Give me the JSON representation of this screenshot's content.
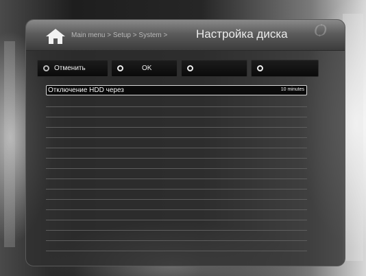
{
  "header": {
    "breadcrumb": "Main menu > Setup > System >",
    "title": "Настройка диска",
    "brand": "Ѻ"
  },
  "buttons": [
    {
      "label": "Отменить",
      "icon": "red-circle-icon"
    },
    {
      "label": "OK",
      "icon": "green-circle-icon"
    },
    {
      "label": "",
      "icon": "yellow-circle-icon"
    },
    {
      "label": "",
      "icon": "blue-circle-icon"
    }
  ],
  "settings": [
    {
      "label": "Отключение HDD через",
      "value": "10 minutes",
      "selected": true
    }
  ],
  "empty_row_count": 15
}
